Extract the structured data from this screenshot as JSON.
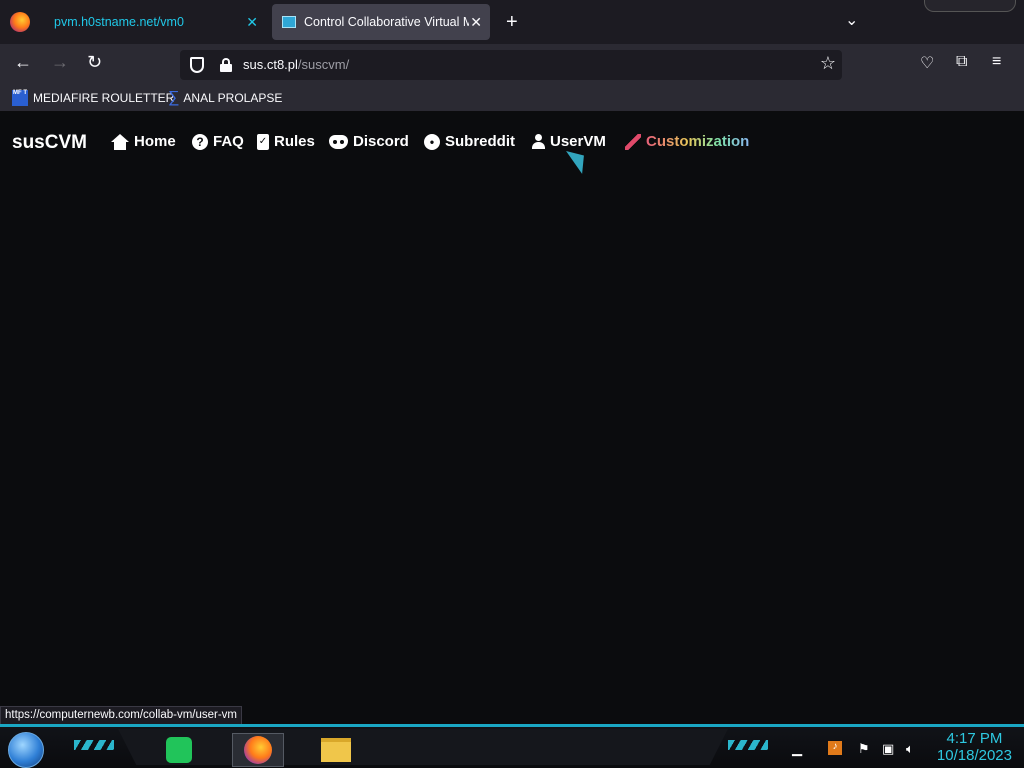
{
  "browser": {
    "tabs": [
      {
        "label": "pvm.h0stname.net/vm0",
        "active": false
      },
      {
        "label": "Control Collaborative Virtual M",
        "active": true
      }
    ],
    "url_domain": "sus.ct8.pl",
    "url_path": "/suscvm/",
    "bookmarks": [
      {
        "label": "MEDIAFIRE ROULETTER",
        "icon_text": "MF T"
      },
      {
        "label": "ANAL PROLAPSE",
        "icon": "sigma-icon"
      }
    ],
    "status_link": "https://computernewb.com/collab-vm/user-vm"
  },
  "site": {
    "brand": "susCVM",
    "nav": [
      {
        "label": "Home",
        "icon": "home-icon"
      },
      {
        "label": "FAQ",
        "icon": "question-icon",
        "icon_glyph": "?"
      },
      {
        "label": "Rules",
        "icon": "clipboard-icon"
      },
      {
        "label": "Discord",
        "icon": "discord-icon"
      },
      {
        "label": "Subreddit",
        "icon": "reddit-icon"
      },
      {
        "label": "UserVM",
        "icon": "user-icon"
      },
      {
        "label": "Customization",
        "icon": "brush-icon"
      }
    ]
  },
  "taskbar": {
    "time": "4:17 PM",
    "date": "10/18/2023",
    "accent": "#2ec8e0"
  }
}
